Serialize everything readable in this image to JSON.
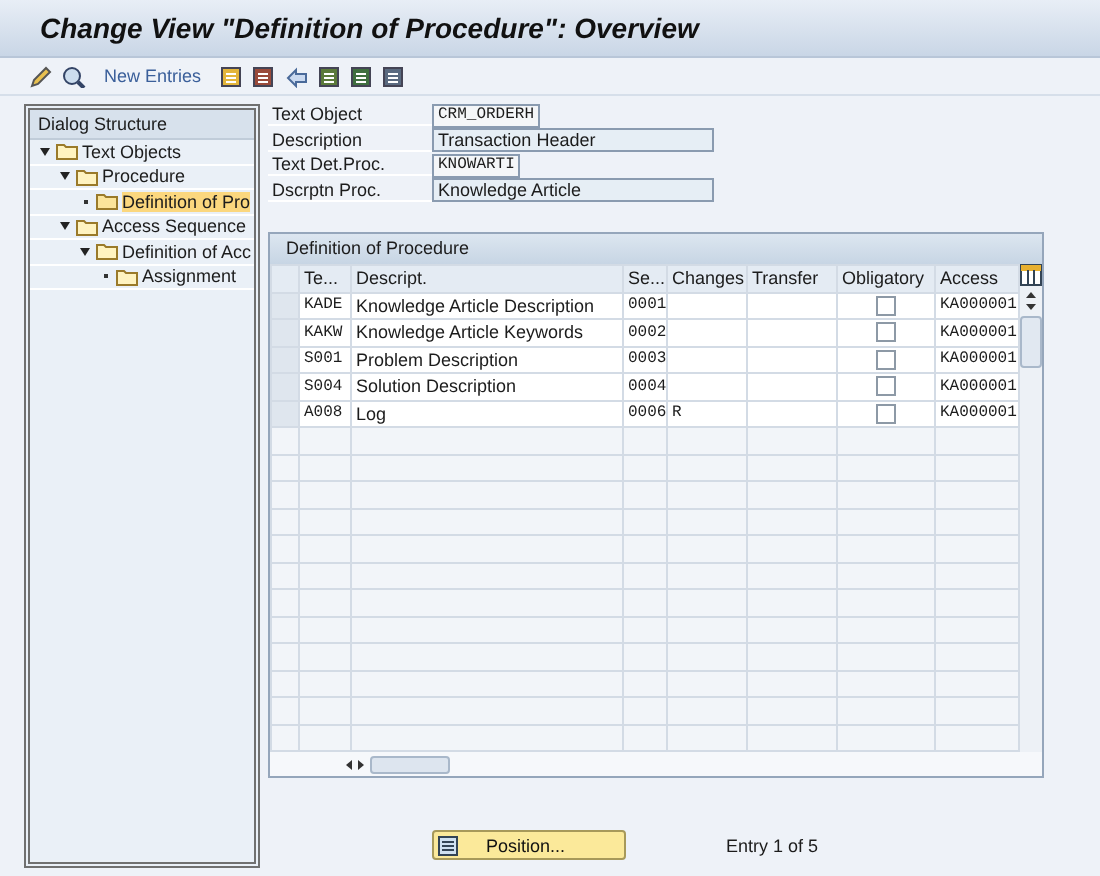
{
  "window": {
    "title": "Change View \"Definition of Procedure\": Overview"
  },
  "toolbar": {
    "new_entries": "New Entries"
  },
  "dialog_structure": {
    "title": "Dialog Structure",
    "items": [
      {
        "label": "Text Objects",
        "expanded": true,
        "selected": false,
        "children": [
          {
            "label": "Procedure",
            "expanded": true,
            "selected": false,
            "children": [
              {
                "label": "Definition of Pro",
                "expanded": false,
                "selected": true
              }
            ]
          },
          {
            "label": "Access Sequence",
            "expanded": true,
            "selected": false,
            "children": [
              {
                "label": "Definition of Acc",
                "expanded": true,
                "selected": false,
                "children": [
                  {
                    "label": "Assignment",
                    "expanded": false,
                    "selected": false
                  }
                ]
              }
            ]
          }
        ]
      }
    ]
  },
  "header_fields": [
    {
      "label": "Text Object",
      "value": "CRM_ORDERH",
      "kind": "key"
    },
    {
      "label": "Description",
      "value": "Transaction Header",
      "kind": "text"
    },
    {
      "label": "Text Det.Proc.",
      "value": "KNOWARTI",
      "kind": "key"
    },
    {
      "label": "Dscrptn Proc.",
      "value": "Knowledge Article",
      "kind": "text"
    }
  ],
  "table": {
    "title": "Definition of Procedure",
    "columns": [
      "Te...",
      "Descript.",
      "Se...",
      "Changes",
      "Transfer",
      "Obligatory",
      "Access"
    ],
    "rows": [
      {
        "text_id": "KADE",
        "description": "Knowledge Article Description",
        "seq": "0001",
        "changes": "",
        "transfer": "",
        "obligatory": false,
        "access": "KA000001"
      },
      {
        "text_id": "KAKW",
        "description": "Knowledge Article Keywords",
        "seq": "0002",
        "changes": "",
        "transfer": "",
        "obligatory": false,
        "access": "KA000001"
      },
      {
        "text_id": "S001",
        "description": "Problem Description",
        "seq": "0003",
        "changes": "",
        "transfer": "",
        "obligatory": false,
        "access": "KA000001"
      },
      {
        "text_id": "S004",
        "description": "Solution Description",
        "seq": "0004",
        "changes": "",
        "transfer": "",
        "obligatory": false,
        "access": "KA000001"
      },
      {
        "text_id": "A008",
        "description": "Log",
        "seq": "0006",
        "changes": "R",
        "transfer": "",
        "obligatory": false,
        "access": "KA000001"
      }
    ]
  },
  "footer": {
    "position_button": "Position...",
    "entry_info": "Entry 1 of 5"
  }
}
